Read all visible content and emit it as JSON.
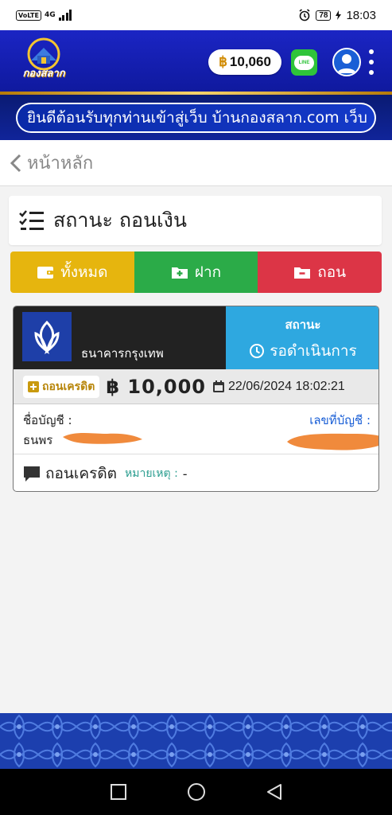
{
  "statusbar": {
    "network": "VoLTE",
    "signal_type": "4G",
    "battery": "78",
    "time": "18:03"
  },
  "header": {
    "logo_text": "กองสลาก",
    "balance_currency": "฿",
    "balance": "10,060",
    "line_label": "LINE"
  },
  "marquee": {
    "text": "ยินดีต้อนรับทุกท่านเข้าสู่เว็บ บ้านกองสลาก.com เว็บ"
  },
  "breadcrumb": {
    "label": "หน้าหลัก"
  },
  "page_title": "สถานะ ถอนเงิน",
  "filters": {
    "all": "ทั้งหมด",
    "deposit": "ฝาก",
    "withdraw": "ถอน"
  },
  "transaction": {
    "bank_name": "ธนาคารกรุงเทพ",
    "status_label": "สถานะ",
    "status_value": "รอดำเนินการ",
    "type_badge": "ถอนเครดิต",
    "currency": "฿",
    "amount": "10,000",
    "datetime": "22/06/2024 18:02:21",
    "account_name_label": "ชื่อบัญชี :",
    "account_name_prefix": "ธนพร",
    "account_number_label": "เลขที่บัญชี :",
    "account_number_prefix": "",
    "note_type": "ถอนเครดิต",
    "note_label": "หมายเหตุ :",
    "note_value": "-"
  },
  "colors": {
    "appbar": "#1b25c4",
    "all_filter": "#e6b50e",
    "deposit_filter": "#2bab48",
    "withdraw_filter": "#dc3546",
    "status": "#2ea8e0",
    "bank": "#1e3fa8"
  }
}
